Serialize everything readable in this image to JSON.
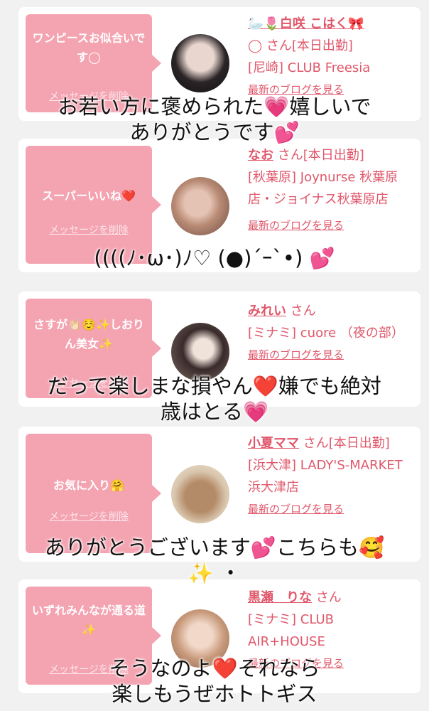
{
  "cards": [
    {
      "message": "ワンピースお似合いです◯",
      "delete_label": "メッセージを削除",
      "name": "🦢🌷白咲 こはく🎀",
      "status": "◯ さん[本日出勤]",
      "shop": "[尼崎] CLUB Freesia",
      "blog": "最新のブログを見る"
    },
    {
      "message": "スーパーいいね❤️",
      "delete_label": "メッセージを削除",
      "name": "なお",
      "status": "さん[本日出勤]",
      "shop": "[秋葉原] Joynurse 秋葉原店・ジョイナス秋葉原店",
      "blog": "最新のブログを見る"
    },
    {
      "message": "さすが👏🏻☺️✨しおりん美女✨",
      "delete_label": "メッセージを削除",
      "name": "みれい",
      "status": "さん",
      "shop": "[ミナミ] cuore （夜の部）",
      "blog": "最新のブログを見る"
    },
    {
      "message": "お気に入り🤗",
      "delete_label": "メッセージを削除",
      "name": "小夏ママ",
      "status": "さん[本日出勤]",
      "shop": "[浜大津] LADY'S-MARKET 浜大津店",
      "blog": "最新のブログを見る"
    },
    {
      "message": "いずれみんなが通る道✨",
      "delete_label": "メッセージを削除",
      "name": "黒瀬　りな",
      "status": "さん",
      "shop": "[ミナミ] CLUB AIR+HOUSE",
      "blog": "最新のブログを見る"
    }
  ],
  "overlays": [
    {
      "line1": "お若い方に褒められた💗嬉しいで",
      "line2": "ありがとうです💕"
    },
    {
      "line1": "((((ﾉ･ω･)ﾉ♡ (●)´ｰ`•) 💕"
    },
    {
      "line1": "だって楽しまな損やん❤️嫌でも絶対",
      "line2": "歳はとる💗"
    },
    {
      "line1": "ありがとうございます💕こちらも🥰",
      "line2": "✨ ・"
    },
    {
      "line1": "そうなのよ❤️それなら",
      "line2": "楽しもうぜホトトギス"
    }
  ],
  "colors": {
    "bubble": "#f4a3b1",
    "link": "#e0576a",
    "background": "#f1f1f1"
  }
}
